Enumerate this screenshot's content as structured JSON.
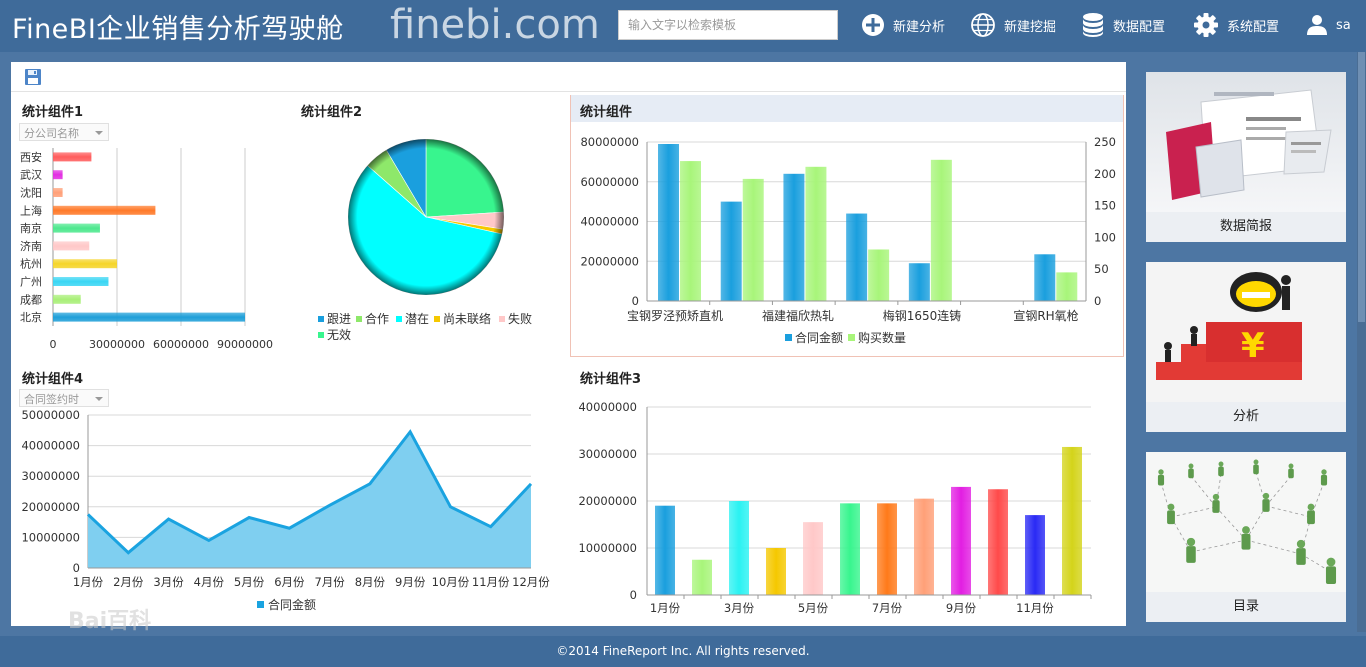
{
  "header": {
    "title": "FineBI企业销售分析驾驶舱",
    "watermark": "finebi.com",
    "search_placeholder": "输入文字以检索模板",
    "nav": [
      {
        "label": "新建分析",
        "icon": "plus-circle-icon"
      },
      {
        "label": "新建挖掘",
        "icon": "globe-icon"
      },
      {
        "label": "数据配置",
        "icon": "database-icon"
      },
      {
        "label": "系统配置",
        "icon": "gear-icon"
      },
      {
        "label": "sa",
        "icon": "user-icon"
      }
    ]
  },
  "widgets": {
    "w1": {
      "title": "统计组件1",
      "filter": "分公司名称"
    },
    "w2": {
      "title": "统计组件2"
    },
    "w3": {
      "title": "统计组件"
    },
    "w4": {
      "title": "统计组件4",
      "filter": "合同签约时"
    },
    "w5": {
      "title": "统计组件3"
    }
  },
  "cards": [
    {
      "label": "数据简报"
    },
    {
      "label": "分析"
    },
    {
      "label": "目录"
    }
  ],
  "footer": "©2014 FineReport Inc. All rights reserved.",
  "watermark_bottom": "Bai百科",
  "chart_data": [
    {
      "type": "bar",
      "orientation": "horizontal",
      "categories": [
        "西安",
        "武汉",
        "沈阳",
        "上海",
        "南京",
        "济南",
        "杭州",
        "广州",
        "成都",
        "北京"
      ],
      "values": [
        18000000,
        4500000,
        4500000,
        48000000,
        22000000,
        17000000,
        30000000,
        26000000,
        13000000,
        90000000
      ],
      "colors": [
        "#ff5c5c",
        "#e22ee2",
        "#ffa078",
        "#ff7a2a",
        "#4ee88e",
        "#ffc8c8",
        "#f5d52a",
        "#3ad6f4",
        "#a9ef78",
        "#1f9fd8"
      ],
      "xticks": [
        "0",
        "30000000",
        "60000000",
        "90000000"
      ],
      "xlim": [
        0,
        90000000
      ]
    },
    {
      "type": "pie",
      "slices": [
        {
          "name": "跟进",
          "value": 8.5,
          "color": "#1a9fde"
        },
        {
          "name": "合作",
          "value": 5,
          "color": "#8ee86a"
        },
        {
          "name": "潜在",
          "value": 58,
          "color": "#00ffff"
        },
        {
          "name": "尚未联络",
          "value": 1,
          "color": "#f5c800"
        },
        {
          "name": "失败",
          "value": 3.5,
          "color": "#ffc8c8"
        },
        {
          "name": "无效",
          "value": 24,
          "color": "#38f58e"
        }
      ]
    },
    {
      "type": "bar",
      "categories": [
        "宝钢罗泾预矫直机",
        "福建福欣热轧",
        "梅钢1650连铸",
        "宣钢RH氧枪",
        "",
        ""
      ],
      "series": [
        {
          "name": "合同金额",
          "axis": "left",
          "color": "#1a9fde",
          "values": [
            79000000,
            50000000,
            64000000,
            44000000,
            19000000,
            0,
            23500000
          ]
        },
        {
          "name": "购买数量",
          "axis": "right",
          "color": "#a8f57a",
          "values": [
            220,
            192,
            211,
            81,
            222,
            0,
            45
          ]
        }
      ],
      "ylim": [
        0,
        80000000
      ],
      "y2lim": [
        0,
        250
      ],
      "yticks": [
        "0",
        "20000000",
        "40000000",
        "60000000",
        "80000000"
      ],
      "y2ticks": [
        "0",
        "50",
        "100",
        "150",
        "200",
        "250"
      ],
      "xlabels": [
        "宝钢罗泾预矫直机",
        "福建福欣热轧",
        "梅钢1650连铸",
        "宣钢RH氧枪"
      ]
    },
    {
      "type": "area",
      "categories": [
        "1月份",
        "2月份",
        "3月份",
        "4月份",
        "5月份",
        "6月份",
        "7月份",
        "8月份",
        "9月份",
        "10月份",
        "11月份",
        "12月份"
      ],
      "series": [
        {
          "name": "合同金额",
          "color": "#1aa3e0",
          "values": [
            17500000,
            5000000,
            16000000,
            9000000,
            16500000,
            13000000,
            20500000,
            27500000,
            44500000,
            20000000,
            13500000,
            27500000
          ]
        }
      ],
      "ylim": [
        0,
        50000000
      ],
      "yticks": [
        "0",
        "10000000",
        "20000000",
        "30000000",
        "40000000",
        "50000000"
      ]
    },
    {
      "type": "bar",
      "categories": [
        "1月份",
        "2月份",
        "3月份",
        "4月份",
        "5月份",
        "6月份",
        "7月份",
        "8月份",
        "9月份",
        "10月份",
        "11月份",
        "12月份"
      ],
      "values": [
        19000000,
        7500000,
        20000000,
        10000000,
        15500000,
        19500000,
        19500000,
        20500000,
        23000000,
        22500000,
        17000000,
        31500000
      ],
      "colors": [
        "#1a9fde",
        "#a8f57a",
        "#2af2f2",
        "#f5c800",
        "#ffc8c8",
        "#38f58e",
        "#ff7a1a",
        "#ffa078",
        "#e21ee2",
        "#ff4a4a",
        "#2a2af5",
        "#d4d41a"
      ],
      "xlabels": [
        "1月份",
        "3月份",
        "5月份",
        "7月份",
        "9月份",
        "11月份"
      ],
      "ylim": [
        0,
        40000000
      ],
      "yticks": [
        "0",
        "10000000",
        "20000000",
        "30000000",
        "40000000"
      ]
    }
  ]
}
